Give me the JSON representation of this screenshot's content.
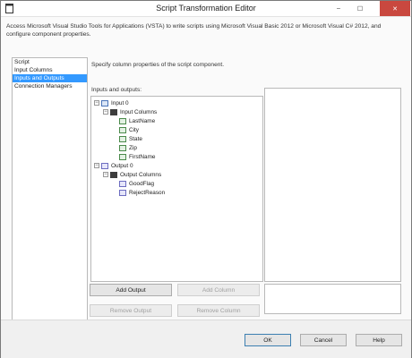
{
  "window": {
    "title": "Script Transformation Editor",
    "controls": {
      "minimize": "–",
      "maximize": "☐",
      "close": "✕"
    }
  },
  "description": "Access Microsoft Visual Studio Tools for Applications (VSTA) to write scripts using Microsoft Visual Basic 2012 or Microsoft Visual C# 2012, and configure component properties.",
  "nav": {
    "items": [
      {
        "label": "Script"
      },
      {
        "label": "Input Columns"
      },
      {
        "label": "Inputs and Outputs"
      },
      {
        "label": "Connection Managers"
      }
    ],
    "selected_index": 2
  },
  "hint": "Specify column properties of the script component.",
  "io_label": "Inputs and outputs:",
  "tree": {
    "input": "Input 0",
    "input_columns_folder": "Input Columns",
    "input_columns": [
      "LastName",
      "City",
      "State",
      "Zip",
      "FirstName"
    ],
    "output": "Output 0",
    "output_columns_folder": "Output Columns",
    "output_columns": [
      "GoodFlag",
      "RejectReason"
    ],
    "expander_symbol": "−"
  },
  "buttons": {
    "add_output": "Add Output",
    "add_column": "Add Column",
    "remove_output": "Remove Output",
    "remove_column": "Remove Column",
    "ok": "OK",
    "cancel": "Cancel",
    "help": "Help"
  },
  "colors": {
    "selection": "#3399ff",
    "close_button": "#c9483f"
  }
}
